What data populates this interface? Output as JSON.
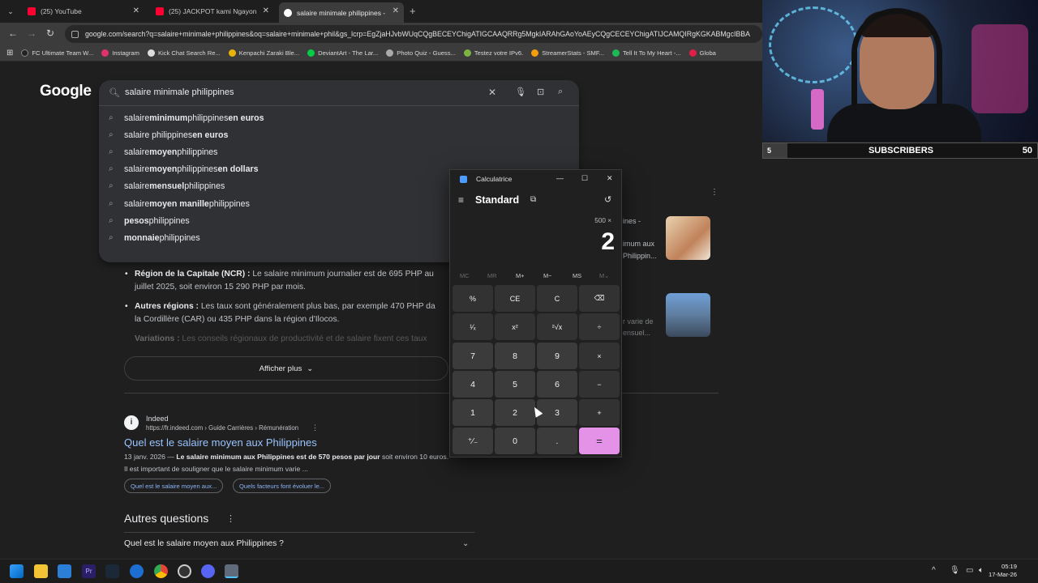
{
  "browser": {
    "tabs": [
      {
        "label": "(25) YouTube"
      },
      {
        "label": "(25) JACKPOT kami Ngayon at"
      },
      {
        "label": "salaire minimale philippines - R"
      }
    ],
    "url": "google.com/search?q=salaire+minimale+philippines&oq=salaire+minimale+phil&gs_lcrp=EgZjaHJvbWUqCQgBECEYChigATIGCAAQRRg5MgkIARAhGAoYoAEyCQgCECEYChigATIJCAMQIRgKGKABMgcIBBA",
    "bookmarks": [
      "FC Ultimate Team W...",
      "Instagram",
      "Kick Chat Search Re...",
      "Kenpachi Zaraki Ble...",
      "DeviantArt - The Lar...",
      "Photo Quiz - Guess...",
      "Testez votre IPv6.",
      "StreamerStats - SMF...",
      "Tell It To My Heart -...",
      "Globa"
    ]
  },
  "google": {
    "logo": "Google",
    "query": "salaire minimale philippines",
    "suggestions": [
      {
        "pre": "salaire ",
        "bold": "minimum",
        "post": " philippines ",
        "bold2": "en euros"
      },
      {
        "pre": "salaire philippines ",
        "bold": "en euros",
        "post": "",
        "bold2": ""
      },
      {
        "pre": "salaire ",
        "bold": "moyen",
        "post": " philippines",
        "bold2": ""
      },
      {
        "pre": "salaire ",
        "bold": "moyen",
        "post": " philippines ",
        "bold2": "en dollars"
      },
      {
        "pre": "salaire ",
        "bold": "mensuel",
        "post": " philippines",
        "bold2": ""
      },
      {
        "pre": "salaire ",
        "bold": "moyen manille",
        "post": " philippines",
        "bold2": ""
      },
      {
        "pre": "",
        "bold": "pesos",
        "post": " philippines",
        "bold2": ""
      },
      {
        "pre": "",
        "bold": "monnaie",
        "post": " philippines",
        "bold2": ""
      }
    ],
    "bullets": [
      {
        "title": "Région de la Capitale (NCR) :",
        "text": " Le salaire minimum journalier est de 695 PHP au",
        "line2": "juillet 2025, soit environ 15 290 PHP par mois."
      },
      {
        "title": "Autres régions :",
        "text": " Les taux sont généralement plus bas, par exemple 470 PHP da",
        "line2": "la Cordillère (CAR) ou 435 PHP dans la région d'Ilocos."
      },
      {
        "title": "Variations :",
        "text": " Les conseils régionaux de productivité et de salaire fixent ces taux",
        "line2": ""
      }
    ],
    "show_more": "Afficher plus",
    "side_snippets": [
      "ines -",
      "imum aux",
      "Philippin...",
      "r varie de",
      "ensuel..."
    ],
    "result": {
      "site_name": "Indeed",
      "site_path": "https://fr.indeed.com › Guide Carrières › Rémunération",
      "title": "Quel est le salaire moyen aux Philippines",
      "date": "13 janv. 2026 — ",
      "snippet_bold": "Le salaire minimum aux Philippines est de 570 pesos par jour",
      "snippet_rest": " soit environ 10 euros.",
      "snippet2": "Il est important de souligner que le salaire minimum varie ...",
      "chips": [
        "Quel est le salaire moyen aux...",
        "Quels facteurs font évoluer le..."
      ]
    },
    "paa_title": "Autres questions",
    "paa_q1": "Quel est le salaire moyen aux Philippines ?"
  },
  "calculator": {
    "title": "Calculatrice",
    "mode": "Standard",
    "expression": "500 ×",
    "display": "2",
    "memory": [
      "MC",
      "MR",
      "M+",
      "M−",
      "MS",
      "M⌄"
    ],
    "keys": [
      [
        "%",
        "CE",
        "C",
        "⌫"
      ],
      [
        "¹⁄ₓ",
        "x²",
        "²√x",
        "÷"
      ],
      [
        "7",
        "8",
        "9",
        "×"
      ],
      [
        "4",
        "5",
        "6",
        "−"
      ],
      [
        "1",
        "2",
        "3",
        "+"
      ],
      [
        "⁺⁄₋",
        "0",
        ".",
        "="
      ]
    ]
  },
  "stream": {
    "sub_left": "5",
    "sub_label": "SUBSCRIBERS",
    "sub_right": "50"
  },
  "taskbar": {
    "time": "05:19",
    "date": "17-Mar-26"
  },
  "colors": {
    "accent_equals": "#e491e8",
    "link": "#99c3ff",
    "page_bg": "#1f1f1f"
  }
}
